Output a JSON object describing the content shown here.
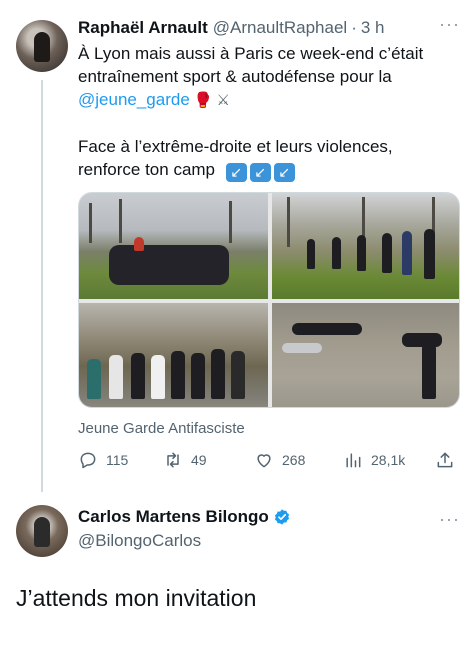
{
  "tweet": {
    "author_name": "Raphaël Arnault",
    "author_handle": "@ArnaultRaphael",
    "separator": "·",
    "time": "3 h",
    "more": "···",
    "text_line1": "À Lyon mais aussi à Paris ce week-end c’était",
    "text_line2": "entraînement sport & autodéfense pour la",
    "mention": "@jeune_garde",
    "emoji_glove": "🥊",
    "emoji_swords": "⚔",
    "text_line3": "Face à l’extrême-droite et leurs violences,",
    "text_line4": "renforce ton camp",
    "arrow_emoji": [
      "↙",
      "↙",
      "↙"
    ],
    "media_caption": "Jeune Garde Antifasciste",
    "stats": {
      "replies": "115",
      "retweets": "49",
      "likes": "268",
      "views": "28,1k"
    },
    "icons": [
      "reply-icon",
      "retweet-icon",
      "like-icon",
      "views-icon",
      "share-icon"
    ]
  },
  "reply": {
    "author_name": "Carlos Martens Bilongo",
    "author_handle": "@BilongoCarlos",
    "more": "···",
    "text": "J’attends mon invitation",
    "verified_color": "#1d9bf0"
  },
  "colors": {
    "link": "#1d9bf0",
    "secondary": "#536471",
    "primary": "#0f1419"
  }
}
